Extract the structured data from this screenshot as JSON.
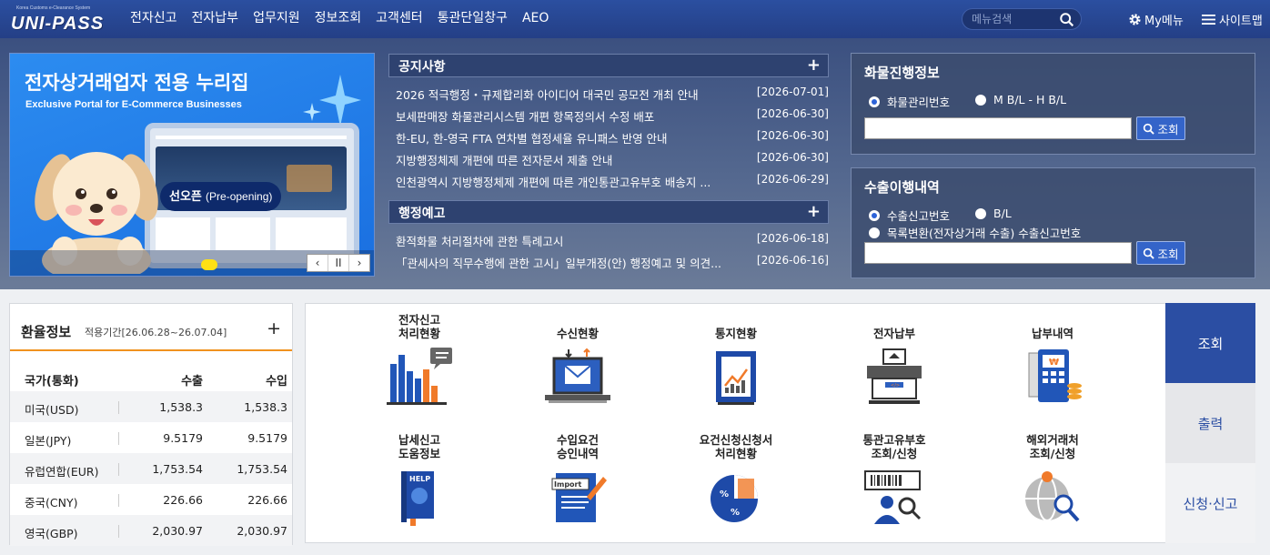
{
  "header": {
    "logo_sub": "Korea Customs e-Clearance System",
    "logo_main": "UNI-PASS",
    "nav": [
      "전자신고",
      "전자납부",
      "업무지원",
      "정보조회",
      "고객센터",
      "통관단일창구",
      "AEO"
    ],
    "search_placeholder": "메뉴검색",
    "mymenu": "My메뉴",
    "sitemap": "사이트맵"
  },
  "banner": {
    "title": "전자상거래업자 전용 누리집",
    "subtitle": "Exclusive Portal for E-Commerce Businesses",
    "badge_main": "선오픈",
    "badge_sub": "(Pre-opening)",
    "controls": [
      "‹",
      "II",
      "›"
    ]
  },
  "notices": {
    "title": "공지사항",
    "more": "+",
    "items": [
      {
        "text": "2026 적극행정・규제합리화 아이디어 대국민 공모전 개최 안내",
        "date": "[2026-07-01]"
      },
      {
        "text": "보세판매장 화물관리시스템 개편 항목정의서 수정 배포",
        "date": "[2026-06-30]"
      },
      {
        "text": "한-EU, 한-영국 FTA 연차별 협정세율 유니패스 반영 안내",
        "date": "[2026-06-30]"
      },
      {
        "text": "지방행정체제 개편에 따른 전자문서 제출 안내",
        "date": "[2026-06-30]"
      },
      {
        "text": "인천광역시 지방행정체제 개편에 따른 개인통관고유부호 배송지 ...",
        "date": "[2026-06-29]"
      }
    ]
  },
  "admin_notices": {
    "title": "행정예고",
    "more": "+",
    "items": [
      {
        "text": "환적화물 처리절차에 관한 특례고시",
        "date": "[2026-06-18]"
      },
      {
        "text": "「관세사의 직무수행에 관한 고시」일부개정(안) 행정예고 및 의견...",
        "date": "[2026-06-16]"
      }
    ]
  },
  "cargo": {
    "title": "화물진행정보",
    "options": [
      "화물관리번호",
      "M B/L - H B/L"
    ],
    "selected": 0,
    "input_value": "",
    "button": "조회"
  },
  "export": {
    "title": "수출이행내역",
    "options": [
      "수출신고번호",
      "B/L",
      "목록변환(전자상거래 수출) 수출신고번호"
    ],
    "selected": 0,
    "input_value": "",
    "button": "조회"
  },
  "rates": {
    "title": "환율정보",
    "period": "적용기간[26.06.28~26.07.04]",
    "more": "+",
    "headers": [
      "국가(통화)",
      "수출",
      "수입"
    ],
    "rows": [
      [
        "미국(USD)",
        "1,538.3",
        "1,538.3"
      ],
      [
        "일본(JPY)",
        "9.5179",
        "9.5179"
      ],
      [
        "유럽연합(EUR)",
        "1,753.54",
        "1,753.54"
      ],
      [
        "중국(CNY)",
        "226.66",
        "226.66"
      ],
      [
        "영국(GBP)",
        "2,030.97",
        "2,030.97"
      ]
    ]
  },
  "quick_menu": [
    {
      "label": "전자신고\n처리현황",
      "icon": "bar-chart-icon"
    },
    {
      "label": "수신현황",
      "icon": "mail-monitor-icon"
    },
    {
      "label": "통지현황",
      "icon": "report-clipboard-icon"
    },
    {
      "label": "전자납부",
      "icon": "payment-machine-icon"
    },
    {
      "label": "납부내역",
      "icon": "card-terminal-icon"
    },
    {
      "label": "납세신고\n도움정보",
      "icon": "help-book-icon"
    },
    {
      "label": "수입요건\n승인내역",
      "icon": "import-document-icon"
    },
    {
      "label": "요건신청신청서\n처리현황",
      "icon": "percent-chart-icon"
    },
    {
      "label": "통관고유부호\n조회/신청",
      "icon": "barcode-person-icon"
    },
    {
      "label": "해외거래처\n조회/신청",
      "icon": "globe-search-icon"
    }
  ],
  "tabs": [
    "조회",
    "출력",
    "신청·신고"
  ],
  "colors": {
    "header": "#2b4fa0",
    "accent": "#f0921e",
    "tab_active": "#2b4ea3",
    "banner": "#2c8cf0"
  }
}
